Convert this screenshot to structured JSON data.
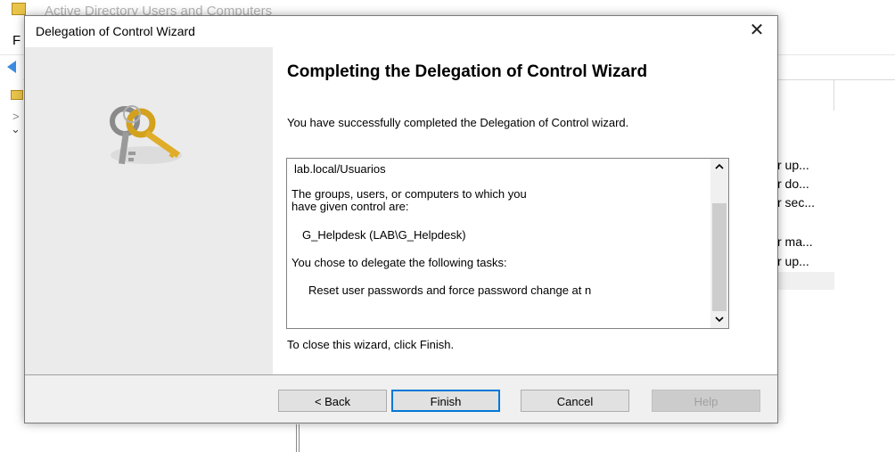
{
  "background_window": {
    "title": "Active Directory Users and Computers",
    "menu_first": "F",
    "descriptions": [
      "r up...",
      "r do...",
      "r sec...",
      "r ma...",
      "r up..."
    ]
  },
  "dialog": {
    "title": "Delegation of Control Wizard",
    "close_glyph": "✕",
    "heading": "Completing the Delegation of Control Wizard",
    "message": "You have successfully completed the Delegation of Control wizard.",
    "summary": {
      "object": "lab.local/Usuarios",
      "groups_intro_line1": "The groups, users, or computers to which you",
      "groups_intro_line2": "have given control are:",
      "group": "G_Helpdesk (LAB\\G_Helpdesk)",
      "tasks_intro": "You chose to delegate the following tasks:",
      "task": "Reset user passwords and force password change at n"
    },
    "close_hint": "To close this wizard, click Finish.",
    "buttons": {
      "back": "< Back",
      "finish": "Finish",
      "cancel": "Cancel",
      "help": "Help"
    }
  },
  "icons": [
    "app-icon",
    "back-arrow-icon",
    "folder-icon",
    "keys-icon",
    "scroll-up-icon",
    "scroll-down-icon",
    "close-icon"
  ],
  "colors": {
    "accent": "#0078d7",
    "wizard_side": "#ebebeb",
    "footer": "#f0f0f0"
  }
}
